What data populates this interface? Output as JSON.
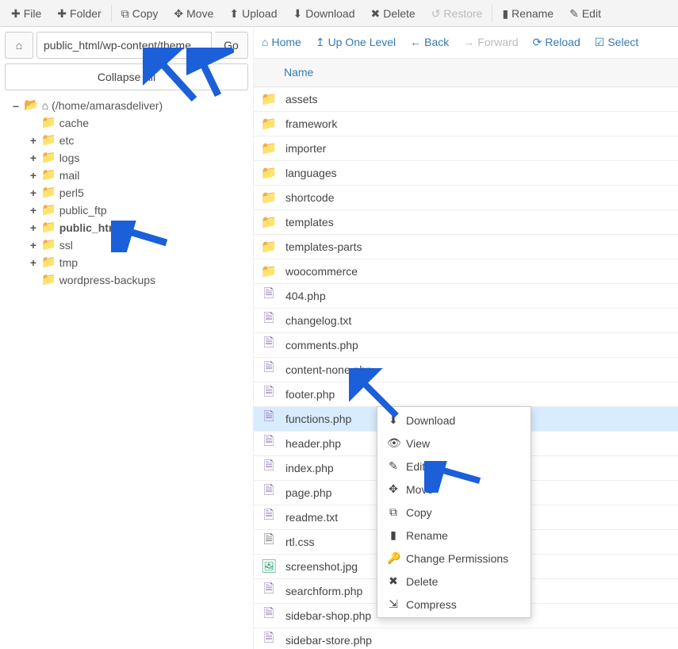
{
  "toolbar": {
    "file": "File",
    "folder": "Folder",
    "copy": "Copy",
    "move": "Move",
    "upload": "Upload",
    "download": "Download",
    "delete": "Delete",
    "restore": "Restore",
    "rename": "Rename",
    "edit": "Edit"
  },
  "path": {
    "value": "public_html/wp-content/theme",
    "go": "Go",
    "collapse": "Collapse All"
  },
  "tree": {
    "root": "(/home/amarasdeliver)",
    "items": [
      {
        "label": "cache",
        "toggle": ""
      },
      {
        "label": "etc",
        "toggle": "+"
      },
      {
        "label": "logs",
        "toggle": "+"
      },
      {
        "label": "mail",
        "toggle": "+"
      },
      {
        "label": "perl5",
        "toggle": "+"
      },
      {
        "label": "public_ftp",
        "toggle": "+"
      },
      {
        "label": "public_html",
        "toggle": "+",
        "bold": true
      },
      {
        "label": "ssl",
        "toggle": "+"
      },
      {
        "label": "tmp",
        "toggle": "+"
      },
      {
        "label": "wordpress-backups",
        "toggle": ""
      }
    ]
  },
  "nav": {
    "home": "Home",
    "up": "Up One Level",
    "back": "Back",
    "forward": "Forward",
    "reload": "Reload",
    "select": "Select"
  },
  "table": {
    "name": "Name"
  },
  "files": [
    {
      "name": "assets",
      "type": "folder"
    },
    {
      "name": "framework",
      "type": "folder"
    },
    {
      "name": "importer",
      "type": "folder"
    },
    {
      "name": "languages",
      "type": "folder"
    },
    {
      "name": "shortcode",
      "type": "folder"
    },
    {
      "name": "templates",
      "type": "folder"
    },
    {
      "name": "templates-parts",
      "type": "folder"
    },
    {
      "name": "woocommerce",
      "type": "folder"
    },
    {
      "name": "404.php",
      "type": "file"
    },
    {
      "name": "changelog.txt",
      "type": "file"
    },
    {
      "name": "comments.php",
      "type": "file"
    },
    {
      "name": "content-none.php",
      "type": "file"
    },
    {
      "name": "footer.php",
      "type": "file"
    },
    {
      "name": "functions.php",
      "type": "file",
      "selected": true
    },
    {
      "name": "header.php",
      "type": "file"
    },
    {
      "name": "index.php",
      "type": "file"
    },
    {
      "name": "page.php",
      "type": "file"
    },
    {
      "name": "readme.txt",
      "type": "file"
    },
    {
      "name": "rtl.css",
      "type": "css"
    },
    {
      "name": "screenshot.jpg",
      "type": "img"
    },
    {
      "name": "searchform.php",
      "type": "file"
    },
    {
      "name": "sidebar-shop.php",
      "type": "file"
    },
    {
      "name": "sidebar-store.php",
      "type": "file"
    }
  ],
  "context": {
    "download": "Download",
    "view": "View",
    "edit": "Edit",
    "move": "Move",
    "copy": "Copy",
    "rename": "Rename",
    "perm": "Change Permissions",
    "delete": "Delete",
    "compress": "Compress"
  }
}
